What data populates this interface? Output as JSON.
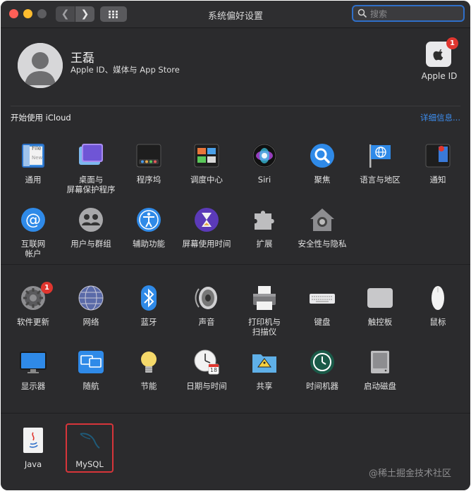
{
  "titlebar": {
    "title": "系统偏好设置",
    "search_placeholder": "搜索"
  },
  "user": {
    "name": "王磊",
    "subtitle": "Apple ID、媒体与 App Store"
  },
  "appleid": {
    "label": "Apple ID",
    "badge": "1"
  },
  "icloud": {
    "text": "开始使用 iCloud",
    "link": "详细信息..."
  },
  "row1": [
    "通用",
    "桌面与\n屏幕保护程序",
    "程序坞",
    "调度中心",
    "Siri",
    "聚焦",
    "语言与地区",
    "通知"
  ],
  "row2": [
    "互联网\n帐户",
    "用户与群组",
    "辅助功能",
    "屏幕使用时间",
    "扩展",
    "安全性与隐私"
  ],
  "row3": [
    "软件更新",
    "网络",
    "蓝牙",
    "声音",
    "打印机与\n扫描仪",
    "键盘",
    "触控板",
    "鼠标"
  ],
  "row3_badge": "1",
  "row4": [
    "显示器",
    "随航",
    "节能",
    "日期与时间",
    "共享",
    "时间机器",
    "启动磁盘"
  ],
  "row5": [
    "Java",
    "MySQL"
  ],
  "calendar_day": "18",
  "java_file_label": "File",
  "java_file_sub": "New",
  "watermark": "@稀土掘金技术社区",
  "colors": {
    "accent": "#2f6fc9",
    "link": "#3d8ef0",
    "badge": "#e0362f",
    "highlight": "#d7353a"
  }
}
